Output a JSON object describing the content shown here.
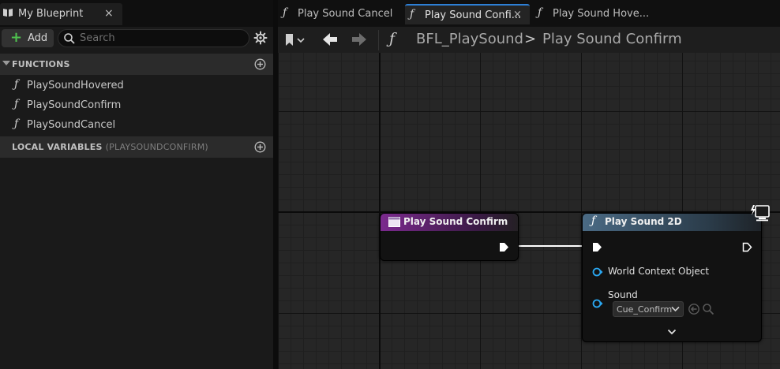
{
  "left_panel": {
    "tab": {
      "title": "My Blueprint",
      "close": "×"
    },
    "toolbar": {
      "add_label": "Add",
      "search_placeholder": "Search"
    },
    "functions": {
      "header": "FUNCTIONS",
      "items": [
        {
          "label": "PlaySoundHovered"
        },
        {
          "label": "PlaySoundConfirm"
        },
        {
          "label": "PlaySoundCancel"
        }
      ]
    },
    "local_variables": {
      "header": "LOCAL VARIABLES",
      "scope": "(PLAYSOUNDCONFIRM)"
    }
  },
  "document_tabs": [
    {
      "label": "Play Sound Cancel",
      "active": false
    },
    {
      "label": "Play Sound Confi...",
      "active": true,
      "close": "×"
    },
    {
      "label": "Play Sound Hove...",
      "active": false
    }
  ],
  "breadcrumb": {
    "library": "BFL_PlaySound",
    "separator": ">",
    "function": "Play Sound Confirm"
  },
  "graph": {
    "entry_node": {
      "title": "Play Sound Confirm"
    },
    "call_node": {
      "title": "Play Sound 2D",
      "pins": {
        "world_context": "World Context Object",
        "sound": "Sound",
        "sound_value": "Cue_Confirm"
      }
    }
  },
  "colors": {
    "entry_header": "#7b2a8e",
    "call_header": "#4a6a84",
    "object_pin": "#2aa8f2",
    "active_tab_accent": "#2d7fd6",
    "add_icon": "#4fc14f"
  },
  "icons": {
    "glyph_f": "ƒ",
    "tab_close": "×",
    "add_plus": "+"
  }
}
